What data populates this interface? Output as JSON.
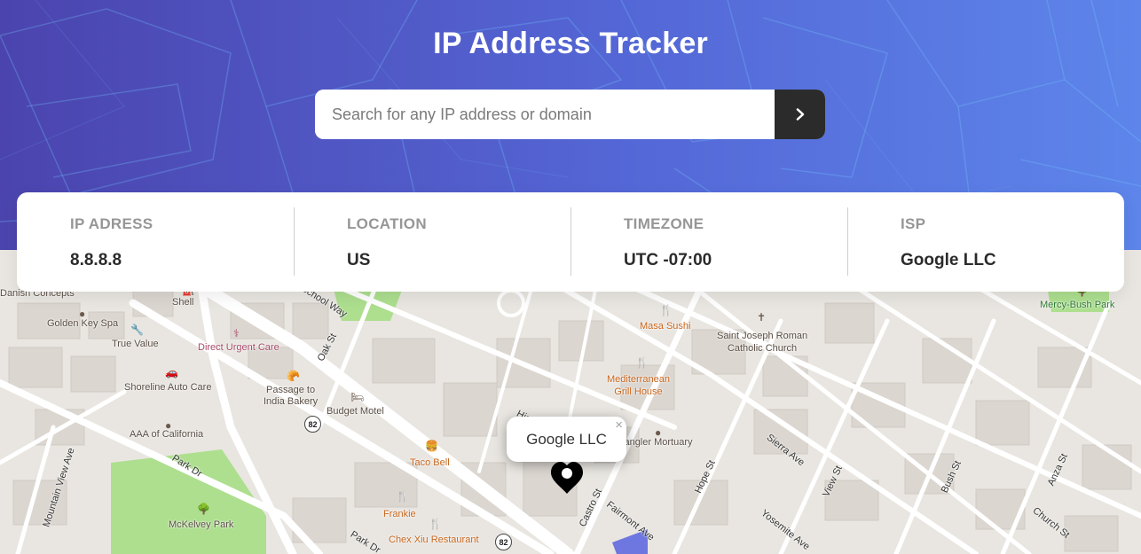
{
  "header": {
    "title": "IP Address Tracker",
    "search_placeholder": "Search for any IP address or domain",
    "search_button_icon": "chevron-right-icon",
    "gradient_colors": [
      "#4b44ae",
      "#5d85ea"
    ]
  },
  "info": {
    "ip": {
      "label": "IP ADRESS",
      "value": "8.8.8.8"
    },
    "location": {
      "label": "LOCATION",
      "value": "US"
    },
    "timezone": {
      "label": "TIMEZONE",
      "value": "UTC -07:00"
    },
    "isp": {
      "label": "ISP",
      "value": "Google LLC"
    }
  },
  "map": {
    "popup_text": "Google LLC",
    "popup_close": "×",
    "marker_icon": "location-marker-icon",
    "places": {
      "danish_concepts": "Danish Concepts",
      "shell": "Shell",
      "golden_key_spa": "Golden Key Spa",
      "true_value": "True Value",
      "direct_urgent_care": "Direct Urgent Care",
      "shoreline_auto_care": "Shoreline Auto Care",
      "passage_to_india_bakery": "Passage to\nIndia Bakery",
      "budget_motel": "Budget Motel",
      "aaa_of_california": "AAA of California",
      "taco_bell": "Taco Bell",
      "frankie": "Frankie",
      "chex_xiu_restaurant": "Chex Xiu Restaurant",
      "mckelvey_park": "McKelvey Park",
      "masa_sushi": "Masa Sushi",
      "mediterranean_grill_house": "Mediterranean\nGrill House",
      "saint_joseph_church": "Saint Joseph Roman\nCatholic Church",
      "spangler_mortuary": "Spangler Mortuary",
      "mercy_bush_park": "Mercy-Bush Park"
    },
    "streets": {
      "school_way": "School Way",
      "oak_st": "Oak St",
      "mountain_view_ave": "Mountain View Ave",
      "park_dr_1": "Park Dr",
      "park_dr_2": "Park Dr",
      "castro_st": "Castro St",
      "fairmont_ave": "Fairmont Ave",
      "hope_st": "Hope St",
      "view_st": "View St",
      "sierra_ave": "Sierra Ave",
      "yosemite_ave": "Yosemite Ave",
      "bush_st": "Bush St",
      "anza_st": "Anza St",
      "church_st": "Church St",
      "hig": "Hig"
    },
    "route_shield_1": "82",
    "route_shield_2": "82"
  }
}
